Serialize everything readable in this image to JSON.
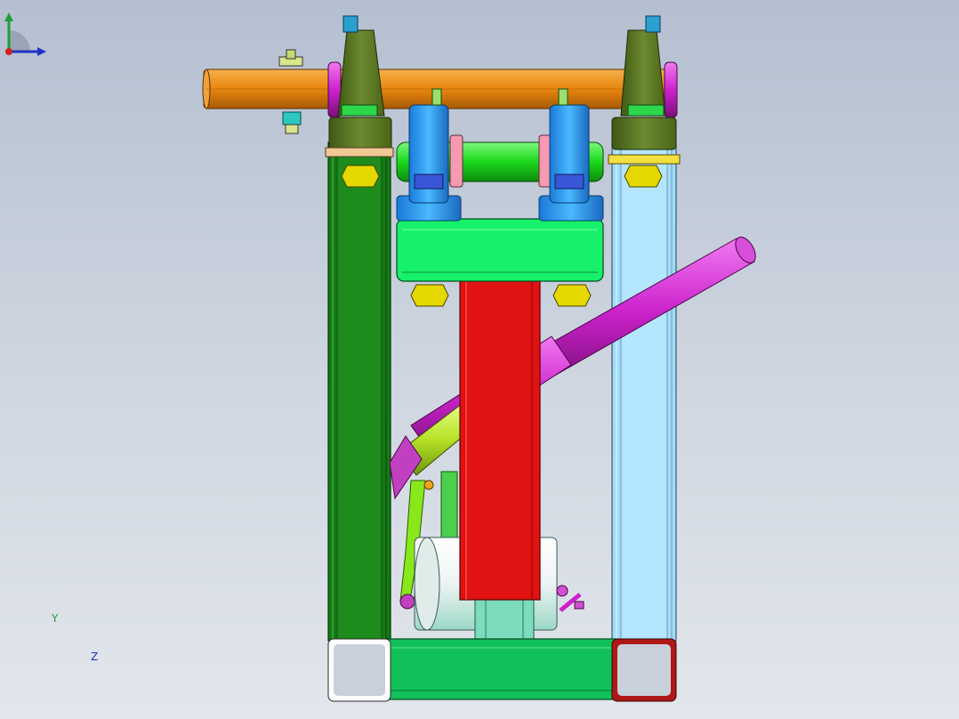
{
  "view": {
    "background_top": "#b4bfd0",
    "background_bottom": "#e2e6ec"
  },
  "model": {
    "parts": [
      {
        "name": "crossbar-rod",
        "color": "#e8860e"
      },
      {
        "name": "left-upright-tube",
        "color": "#167a16"
      },
      {
        "name": "right-upright-tube",
        "color": "#a2dcfa"
      },
      {
        "name": "bottom-crossbeam",
        "color": "#12c05a"
      },
      {
        "name": "center-column",
        "color": "#e01212"
      },
      {
        "name": "clamp-block",
        "color": "#17f06a"
      },
      {
        "name": "guide-rod",
        "color": "#1ad81a"
      },
      {
        "name": "diagonal-cylinder",
        "color": "#cc22cc"
      },
      {
        "name": "pillow-block-bearing",
        "color": "#2aa0f0"
      },
      {
        "name": "end-bearing",
        "color": "#5e7a24"
      },
      {
        "name": "hex-nut",
        "color": "#e4d800"
      },
      {
        "name": "drum",
        "color": "#eef3f3"
      }
    ]
  },
  "triad": {
    "y_label": "Y",
    "z_label": "Z",
    "y_color": "#1e9e3a",
    "z_color": "#2030c8",
    "x_color": "#d02020"
  }
}
